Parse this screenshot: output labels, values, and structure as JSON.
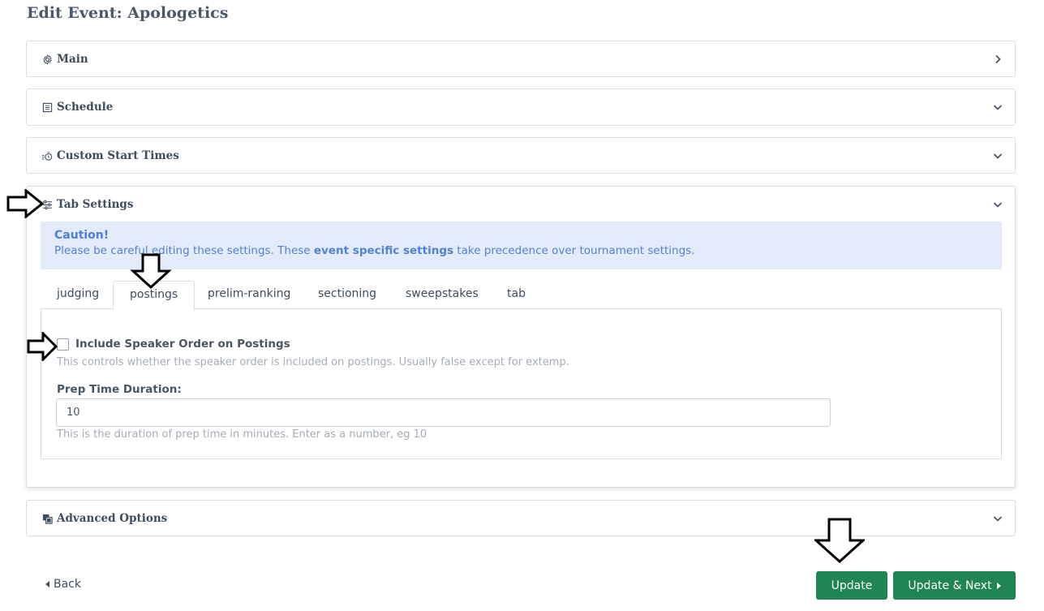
{
  "page": {
    "title": "Edit Event: Apologetics"
  },
  "sections": {
    "main": {
      "title": "Main",
      "icon": "gear-icon"
    },
    "schedule": {
      "title": "Schedule",
      "icon": "calendar-icon"
    },
    "custom_start_times": {
      "title": "Custom Start Times",
      "icon": "stopwatch-icon"
    },
    "tab_settings": {
      "title": "Tab Settings",
      "icon": "sliders-icon"
    },
    "advanced_options": {
      "title": "Advanced Options",
      "icon": "copy-icon"
    }
  },
  "caution": {
    "title": "Caution!",
    "text_before": "Please be careful editing these settings. These ",
    "text_bold": "event specific settings",
    "text_after": " take precedence over tournament settings."
  },
  "tabs": [
    "judging",
    "postings",
    "prelim-ranking",
    "sectioning",
    "sweepstakes",
    "tab"
  ],
  "active_tab": "postings",
  "postings": {
    "speaker_order_label": "Include Speaker Order on Postings",
    "speaker_order_checked": false,
    "speaker_order_help": "This controls whether the speaker order is included on postings. Usually false except for extemp.",
    "prep_time_label": "Prep Time Duration:",
    "prep_time_value": "10",
    "prep_time_help": "This is the duration of prep time in minutes. Enter as a number, eg 10"
  },
  "footer": {
    "back_label": "Back",
    "update_label": "Update",
    "update_next_label": "Update & Next"
  },
  "colors": {
    "primary_button": "#1f8552",
    "alert_bg": "#e3ebfb",
    "alert_text": "#5282d4",
    "annotation_arrow": "#000000"
  }
}
